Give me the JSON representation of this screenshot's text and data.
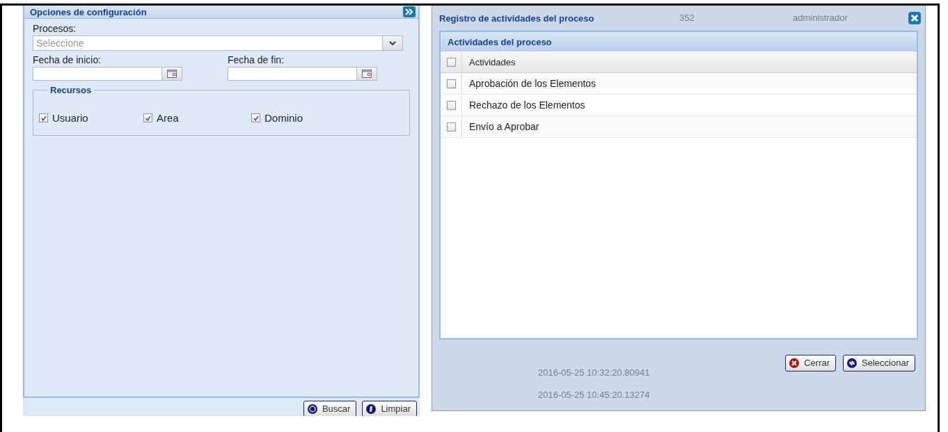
{
  "config_panel": {
    "title": "Opciones de configuración",
    "procesos_label": "Procesos:",
    "procesos_placeholder": "Seleccione",
    "fecha_inicio_label": "Fecha de inicio:",
    "fecha_fin_label": "Fecha de fin:",
    "recursos_legend": "Recursos",
    "recursos": [
      {
        "label": "Usuario",
        "checked": true
      },
      {
        "label": "Area",
        "checked": true
      },
      {
        "label": "Dominio",
        "checked": true
      }
    ],
    "buttons": [
      {
        "label": "Buscar",
        "kind": "search"
      },
      {
        "label": "Limpiar",
        "kind": "clear"
      }
    ]
  },
  "dialog": {
    "title": "Registro de actividades del proceso",
    "panel_title": "Actividades del proceso",
    "background_texts": [
      "352",
      "administrador",
      "2016-05-25 10:32:20.80941",
      "2016-05-25 10:45:20.13274"
    ],
    "table": {
      "header": {
        "label": "Actividades",
        "checked": false
      },
      "rows": [
        {
          "label": "Aprobación de los Elementos",
          "checked": false
        },
        {
          "label": "Rechazo de los Elementos",
          "checked": false
        },
        {
          "label": "Envío a Aprobar",
          "checked": false
        }
      ]
    },
    "buttons": [
      {
        "label": "Cerrar",
        "kind": "close"
      },
      {
        "label": "Seleccionar",
        "kind": "select"
      }
    ]
  }
}
